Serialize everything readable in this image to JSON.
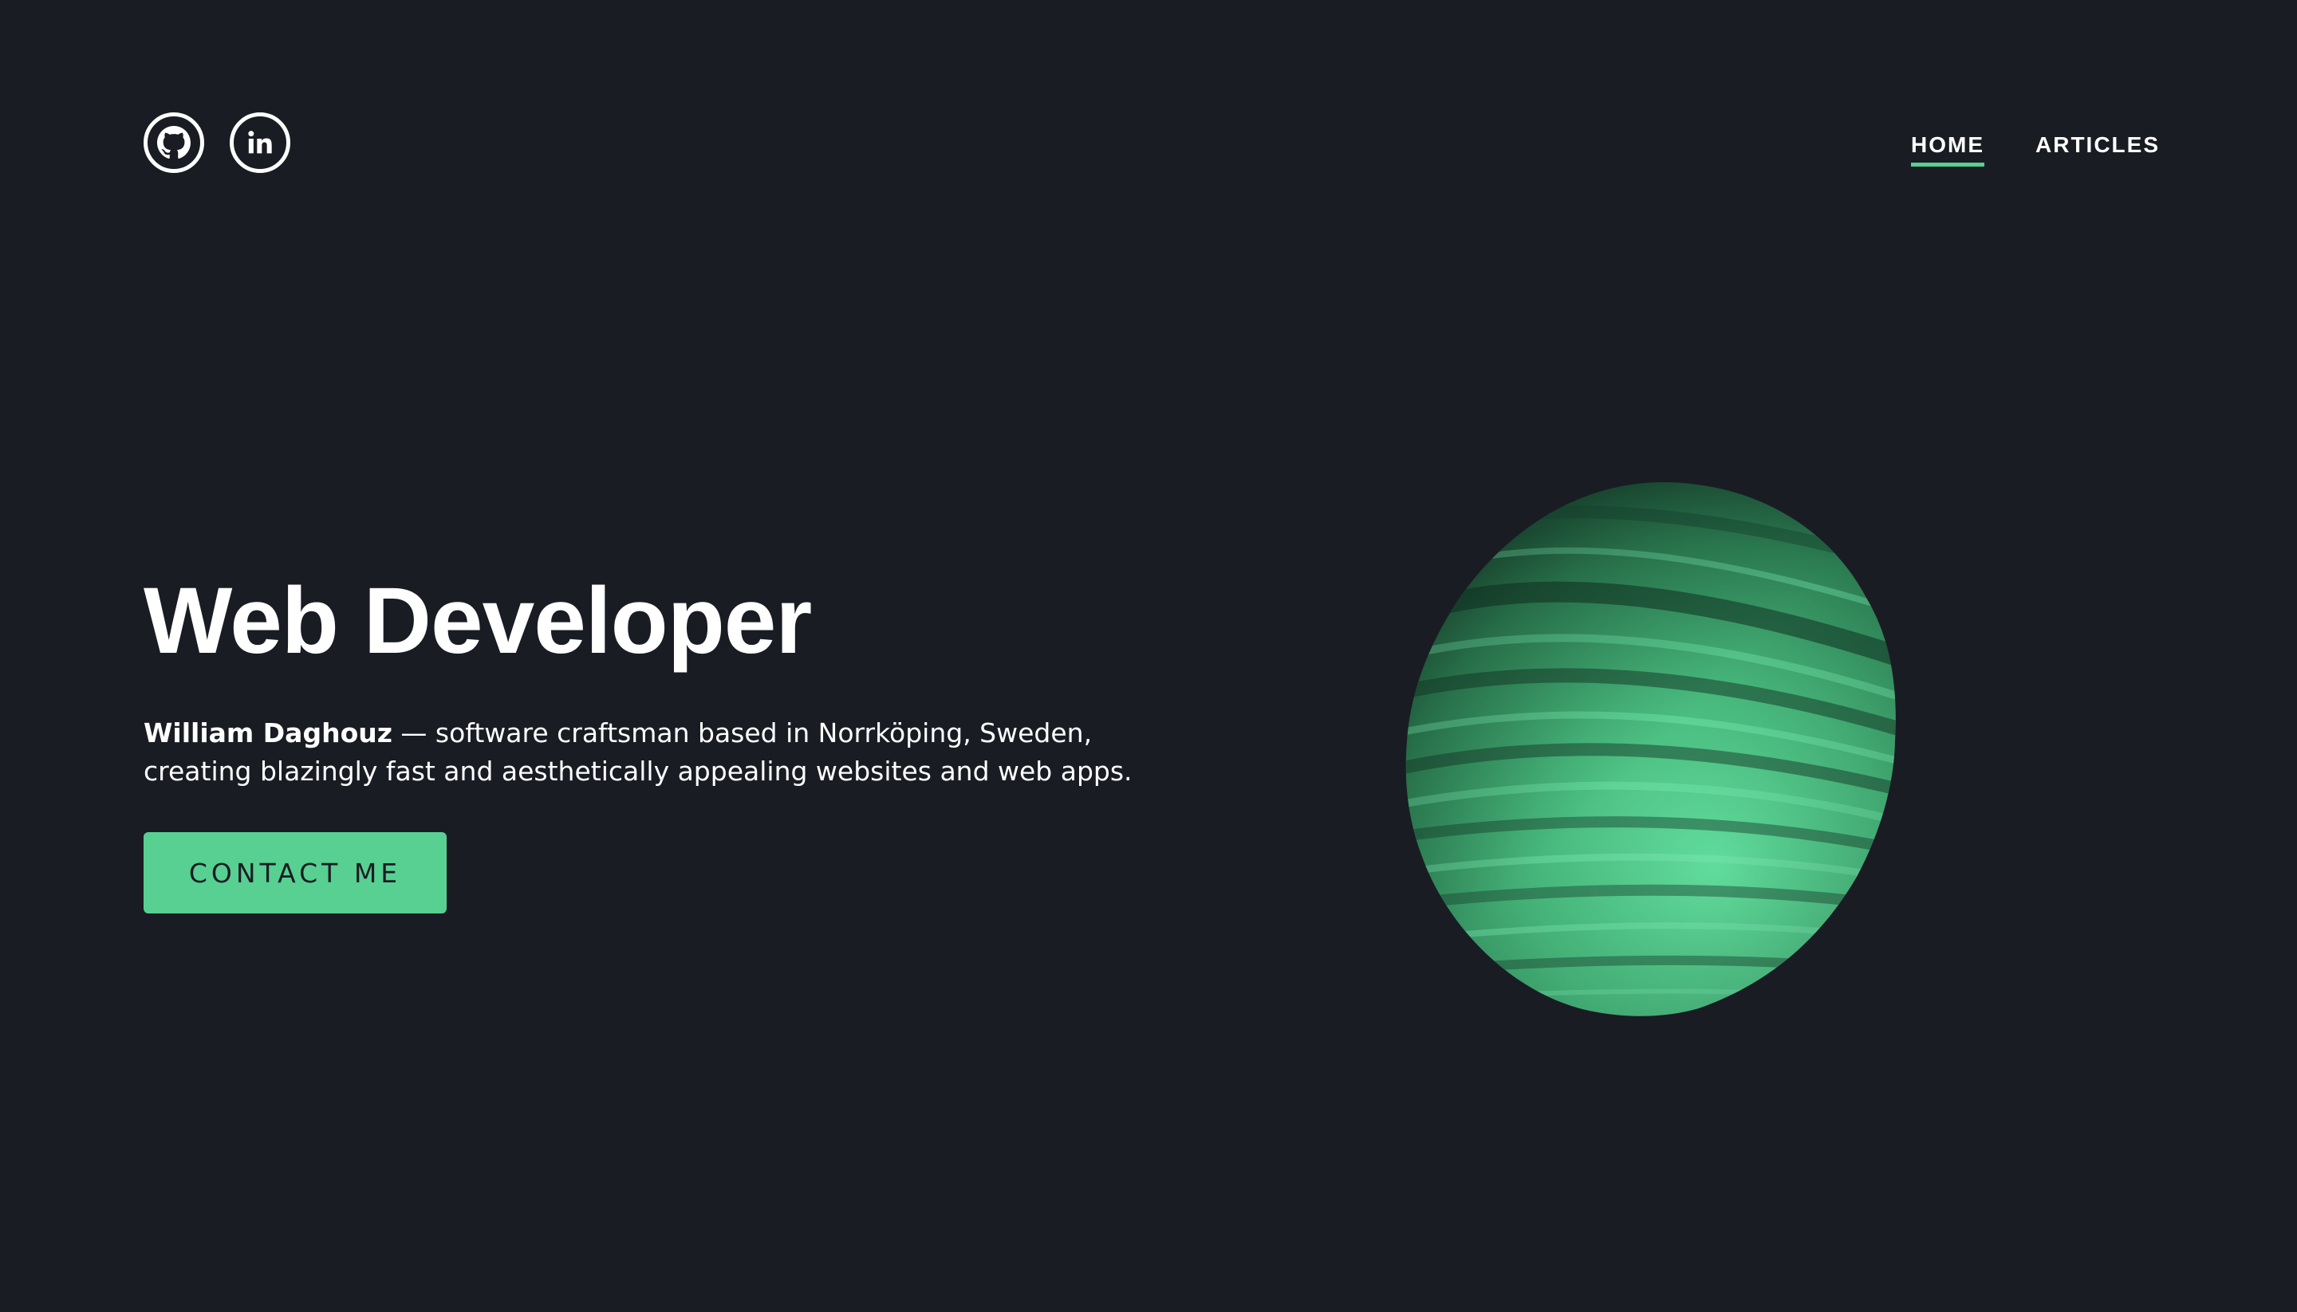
{
  "socials": [
    {
      "name": "github",
      "icon": "github-icon"
    },
    {
      "name": "linkedin",
      "icon": "linkedin-icon",
      "glyph": "in"
    }
  ],
  "nav": {
    "items": [
      {
        "label": "HOME",
        "active": true
      },
      {
        "label": "ARTICLES",
        "active": false
      }
    ]
  },
  "hero": {
    "title": "Web Developer",
    "name": "William Daghouz",
    "description_line1": " — software craftsman based in Norrköping, Sweden,",
    "description_line2": "creating blazingly fast and aesthetically appealing websites and web apps.",
    "cta_label": "CONTACT ME"
  },
  "colors": {
    "background": "#1a1c24",
    "accent": "#57d092",
    "text": "#ffffff"
  }
}
